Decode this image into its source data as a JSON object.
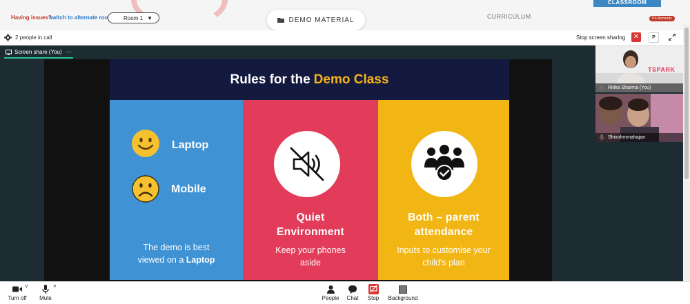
{
  "topbar": {
    "issues_text": "Having issues?",
    "alt_room_link": "switch to alternate room",
    "room_selected": "Room 1",
    "demo_button": "DEMO MATERIAL",
    "curriculum": "CURRICULUM",
    "classroom_tab": "CLASSROOM",
    "ps_badge": "PS Moments"
  },
  "call": {
    "people_count": "2 people in call",
    "stop_sharing": "Stop screen sharing",
    "pin_label": "P"
  },
  "share": {
    "tab_label": "Screen share (You)",
    "tab_more": "···"
  },
  "slide": {
    "title_main": "Rules for the",
    "title_accent": "Demo Class",
    "laptop_label": "Laptop",
    "mobile_label": "Mobile",
    "panel1_line1": "The demo is best",
    "panel1_line2_prefix": "viewed on a ",
    "panel1_line2_bold": "Laptop",
    "panel2_title_1": "Quiet",
    "panel2_title_2": "Environment",
    "panel2_sub_1": "Keep your phones",
    "panel2_sub_2": "aside",
    "panel3_title_1": "Both – parent",
    "panel3_title_2": "attendance",
    "panel3_sub_1": "Inputs to customise your",
    "panel3_sub_2": "child's plan"
  },
  "participants": [
    {
      "name": "Ritika Sharma (You)",
      "logo": "TSPARK"
    },
    {
      "name": "Shivohmmahajan"
    }
  ],
  "toolbar": {
    "camera": "Turn off",
    "mic": "Mute",
    "people": "People",
    "chat": "Chat",
    "stop": "Stop",
    "background": "Background"
  },
  "colors": {
    "panel_blue": "#3f92d4",
    "panel_red": "#e33b5a",
    "panel_yellow": "#f1b514",
    "slide_header": "#14193f",
    "accent_yellow": "#f5b41a",
    "stop_red": "#d93535"
  }
}
